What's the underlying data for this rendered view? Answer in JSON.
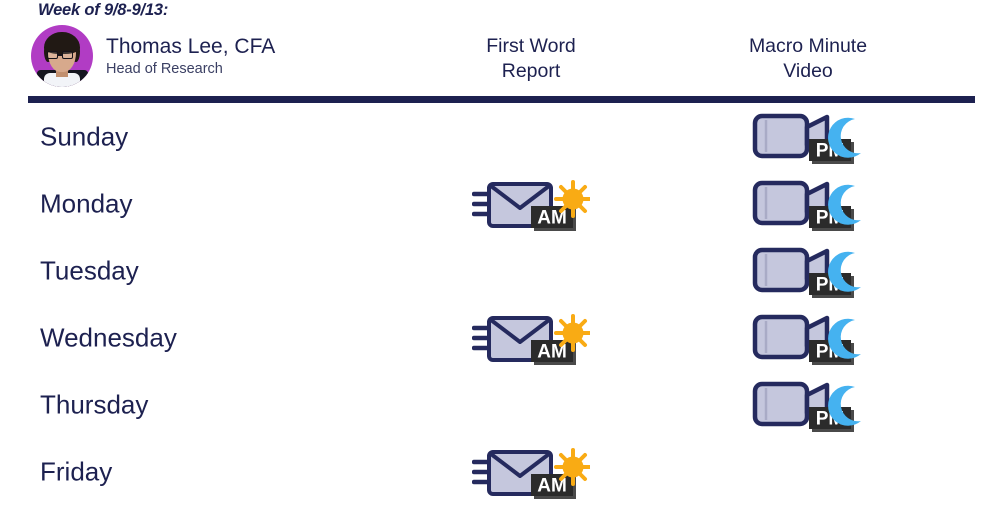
{
  "header": {
    "week_label": "Week of 9/8-9/13:",
    "analyst": {
      "name": "Thomas Lee, CFA",
      "role": "Head of Research",
      "avatar_name": "thomas-lee-headshot",
      "avatar_bg": "#b13cc4"
    },
    "columns": [
      {
        "id": "report",
        "line1": "First Word",
        "line2": "Report"
      },
      {
        "id": "video",
        "line1": "Macro Minute",
        "line2": "Video"
      }
    ],
    "rule_color": "#1d2150"
  },
  "icons": {
    "report": {
      "semantic_name": "email-envelope-am-icon",
      "badge_text": "AM",
      "badge_bg": "#2b2b2b",
      "badge_text_color": "#ffffff",
      "body_fill": "#c5c7dd",
      "outline": "#252a5e",
      "accent_name": "sun-icon",
      "accent_color": "#f9ab14"
    },
    "video": {
      "semantic_name": "video-camera-pm-icon",
      "badge_text": "PM",
      "badge_bg": "#2b2b2b",
      "badge_text_color": "#ffffff",
      "body_fill": "#c5c7dd",
      "outline": "#252a5e",
      "accent_name": "crescent-moon-icon",
      "accent_color": "#45b2f0"
    }
  },
  "rows": [
    {
      "day": "Sunday",
      "report": false,
      "video": true
    },
    {
      "day": "Monday",
      "report": true,
      "video": true
    },
    {
      "day": "Tuesday",
      "report": false,
      "video": true
    },
    {
      "day": "Wednesday",
      "report": true,
      "video": true
    },
    {
      "day": "Thursday",
      "report": false,
      "video": true
    },
    {
      "day": "Friday",
      "report": true,
      "video": false
    }
  ]
}
